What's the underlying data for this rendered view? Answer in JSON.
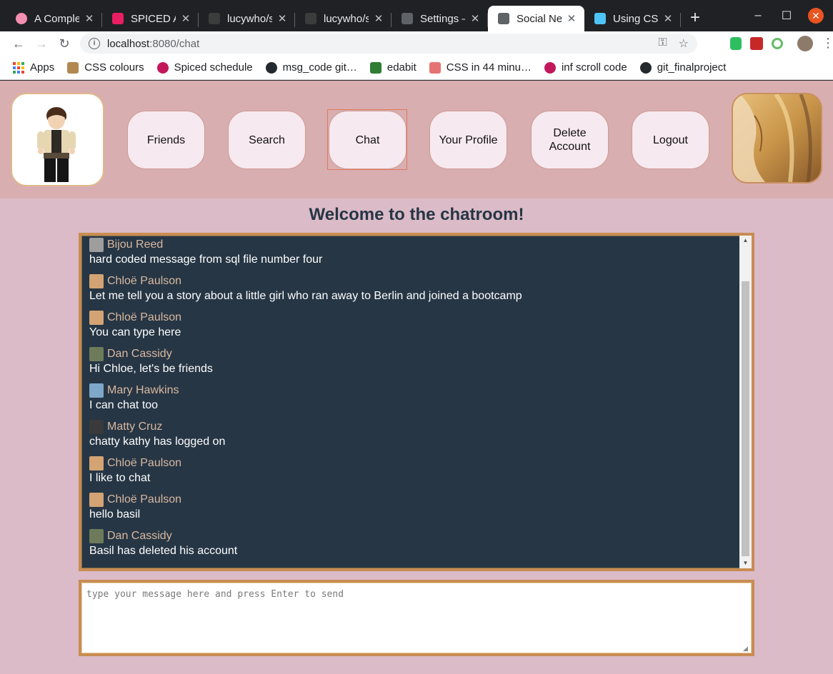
{
  "browser": {
    "tabs": [
      {
        "title": "A Complet",
        "favicon_color": "#f48fb1",
        "active": false
      },
      {
        "title": "SPICED Ac",
        "favicon_color": "#e91e63",
        "active": false
      },
      {
        "title": "lucywho/s",
        "favicon_color": "#3c3c3c",
        "active": false
      },
      {
        "title": "lucywho/s",
        "favicon_color": "#3c3c3c",
        "active": false
      },
      {
        "title": "Settings –",
        "favicon_color": "#5f6368",
        "active": false
      },
      {
        "title": "Social Net",
        "favicon_color": "#5f6368",
        "active": true
      },
      {
        "title": "Using CSS",
        "favicon_color": "#4fc3f7",
        "active": false
      }
    ],
    "new_tab_label": "+",
    "address": {
      "host": "localhost",
      "path": ":8080/chat"
    },
    "bookmarks": [
      {
        "label": "Apps",
        "icon": "apps-grid-icon"
      },
      {
        "label": "CSS colours",
        "icon": "palette-icon",
        "color": "#b08850"
      },
      {
        "label": "Spiced schedule",
        "icon": "spiced-icon",
        "color": "#c2185b"
      },
      {
        "label": "msg_code git…",
        "icon": "github-icon",
        "color": "#24292e"
      },
      {
        "label": "edabit",
        "icon": "edabit-icon",
        "color": "#2e7d32"
      },
      {
        "label": "CSS in 44 minu…",
        "icon": "doc-icon",
        "color": "#e57373"
      },
      {
        "label": "inf scroll code",
        "icon": "spiced-icon",
        "color": "#c2185b"
      },
      {
        "label": "git_finalproject",
        "icon": "github-icon",
        "color": "#24292e"
      }
    ]
  },
  "nav": {
    "buttons": [
      {
        "label": "Friends"
      },
      {
        "label": "Search"
      },
      {
        "label": "Chat",
        "active": true
      },
      {
        "label": "Your Profile"
      },
      {
        "label": "Delete Account"
      },
      {
        "label": "Logout"
      }
    ]
  },
  "chat": {
    "title": "Welcome to the chatroom!",
    "messages": [
      {
        "author": "Bijou Reed",
        "text": "hard coded message from sql file number four",
        "avatar_color": "#9e9e9e"
      },
      {
        "author": "Chloë Paulson",
        "text": "Let me tell you a story about a little girl who ran away to Berlin and joined a bootcamp",
        "avatar_color": "#d4a373"
      },
      {
        "author": "Chloë Paulson",
        "text": "You can type here",
        "avatar_color": "#d4a373"
      },
      {
        "author": "Dan Cassidy",
        "text": "Hi Chloe, let's be friends",
        "avatar_color": "#6d7b5a"
      },
      {
        "author": "Mary Hawkins",
        "text": "I can chat too",
        "avatar_color": "#7fa7c9"
      },
      {
        "author": "Matty Cruz",
        "text": "chatty kathy has logged on",
        "avatar_color": "#3a3a3a"
      },
      {
        "author": "Chloë Paulson",
        "text": "I like to chat",
        "avatar_color": "#d4a373"
      },
      {
        "author": "Chloë Paulson",
        "text": "hello basil",
        "avatar_color": "#d4a373"
      },
      {
        "author": "Dan Cassidy",
        "text": "Basil has deleted his account",
        "avatar_color": "#6d7b5a"
      }
    ],
    "input_placeholder": "type your message here and press Enter to send"
  },
  "colors": {
    "header_bg": "#d8aeb0",
    "page_bg": "#dbbbc7",
    "chat_bg": "#263645",
    "chat_border": "#c98c52",
    "author_color": "#d9b89f",
    "title_color": "#263645"
  }
}
